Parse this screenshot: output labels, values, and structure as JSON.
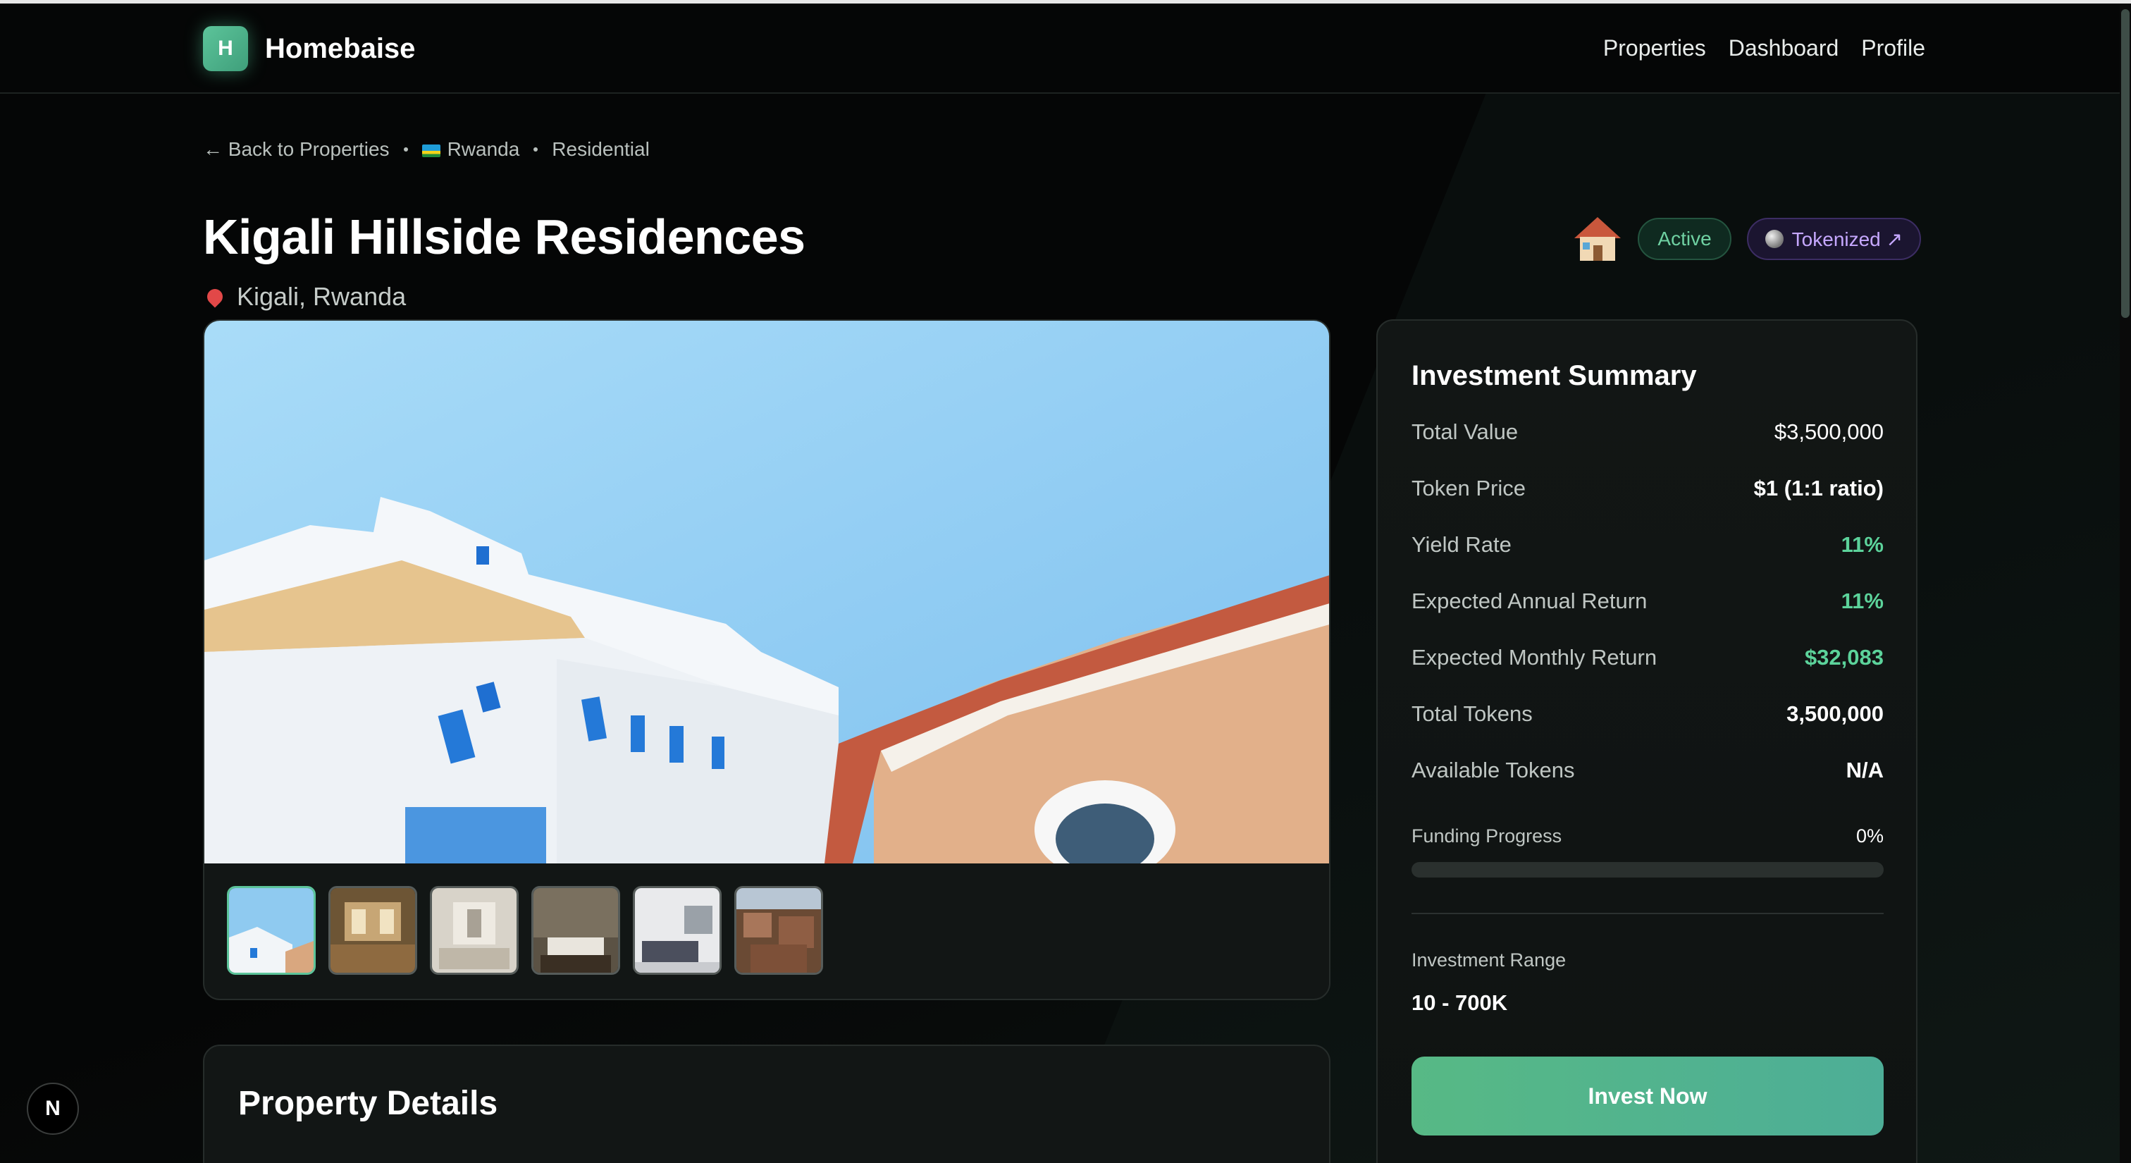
{
  "header": {
    "logo_letter": "H",
    "brand": "Homebaise",
    "nav": [
      "Properties",
      "Dashboard",
      "Profile"
    ]
  },
  "breadcrumb": {
    "back": "← Back to Properties",
    "country": "Rwanda",
    "category": "Residential"
  },
  "property": {
    "title": "Kigali Hillside Residences",
    "location": "Kigali, Rwanda",
    "status_badge": "Active",
    "token_badge": "Tokenized ↗",
    "thumbnail_count": 6,
    "selected_thumbnail": 1
  },
  "investment": {
    "heading": "Investment Summary",
    "rows": [
      {
        "label": "Total Value",
        "value": "$3,500,000"
      },
      {
        "label": "Token Price",
        "value": "$1 (1:1 ratio)"
      },
      {
        "label": "Yield Rate",
        "value": "11%"
      },
      {
        "label": "Expected Annual Return",
        "value": "11%"
      },
      {
        "label": "Expected Monthly Return",
        "value": "$32,083"
      },
      {
        "label": "Total Tokens",
        "value": "3,500,000"
      },
      {
        "label": "Available Tokens",
        "value": "N/A"
      }
    ],
    "funding_label": "Funding Progress",
    "funding_value": "0%",
    "funding_fraction": 0,
    "range_label": "Investment Range",
    "range_value": "10 - 700K",
    "cta": "Invest Now"
  },
  "details": {
    "heading": "Property Details"
  },
  "dev_badge": "N",
  "colors": {
    "accent": "#5cc49a",
    "positive": "#5cd39b",
    "tokenized": "#c6a8ff"
  }
}
